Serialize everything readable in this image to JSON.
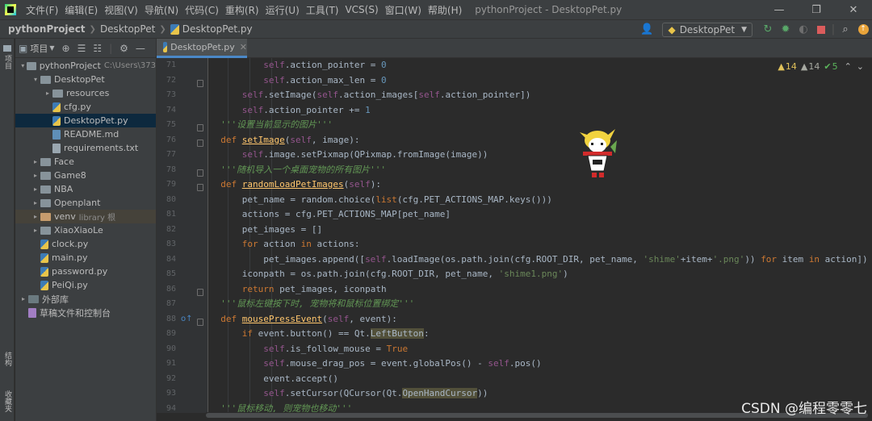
{
  "titlebar": {
    "menu": [
      "文件(F)",
      "编辑(E)",
      "视图(V)",
      "导航(N)",
      "代码(C)",
      "重构(R)",
      "运行(U)",
      "工具(T)",
      "VCS(S)",
      "窗口(W)",
      "帮助(H)"
    ],
    "title": "pythonProject - DesktopPet.py",
    "controls": [
      "—",
      "❐",
      "✕"
    ]
  },
  "navbar": {
    "breadcrumbs": [
      "pythonProject",
      "DesktopPet",
      "DesktopPet.py"
    ],
    "run_config": "DesktopPet"
  },
  "left_strip": {
    "top_label": "项目",
    "bottom_label_1": "结构",
    "bottom_label_2": "收藏夹"
  },
  "project_panel": {
    "label": "项目",
    "tree": [
      {
        "label": "pythonProject",
        "hint": "C:\\Users\\373",
        "indent": 0,
        "type": "folder",
        "arrow": "▾"
      },
      {
        "label": "DesktopPet",
        "indent": 1,
        "type": "folder",
        "arrow": "▾"
      },
      {
        "label": "resources",
        "indent": 2,
        "type": "folder",
        "arrow": "▸"
      },
      {
        "label": "cfg.py",
        "indent": 2,
        "type": "py"
      },
      {
        "label": "DesktopPet.py",
        "indent": 2,
        "type": "py",
        "selected": true
      },
      {
        "label": "README.md",
        "indent": 2,
        "type": "md"
      },
      {
        "label": "requirements.txt",
        "indent": 2,
        "type": "txt"
      },
      {
        "label": "Face",
        "indent": 1,
        "type": "folder",
        "arrow": "▸"
      },
      {
        "label": "Game8",
        "indent": 1,
        "type": "folder",
        "arrow": "▸"
      },
      {
        "label": "NBA",
        "indent": 1,
        "type": "folder",
        "arrow": "▸"
      },
      {
        "label": "Openplant",
        "indent": 1,
        "type": "folder",
        "arrow": "▸"
      },
      {
        "label": "venv",
        "hint": "library 根",
        "indent": 1,
        "type": "folder-orange",
        "arrow": "▸",
        "excluded": true
      },
      {
        "label": "XiaoXiaoLe",
        "indent": 1,
        "type": "folder",
        "arrow": "▸"
      },
      {
        "label": "clock.py",
        "indent": 1,
        "type": "py"
      },
      {
        "label": "main.py",
        "indent": 1,
        "type": "py"
      },
      {
        "label": "password.py",
        "indent": 1,
        "type": "py"
      },
      {
        "label": "PeiQi.py",
        "indent": 1,
        "type": "py"
      },
      {
        "label": "外部库",
        "indent": 0,
        "type": "lib",
        "arrow": "▸"
      },
      {
        "label": "草稿文件和控制台",
        "indent": 0,
        "type": "scratch"
      }
    ]
  },
  "editor": {
    "tab": "DesktopPet.py",
    "inspections": {
      "warnings": "14",
      "weak_warnings": "14",
      "ok": "5"
    },
    "line_numbers": [
      "71",
      "72",
      "73",
      "74",
      "75",
      "76",
      "77",
      "78",
      "79",
      "80",
      "81",
      "82",
      "83",
      "84",
      "85",
      "86",
      "87",
      "88",
      "89",
      "90",
      "91",
      "92",
      "93",
      "94"
    ]
  },
  "watermark": "CSDN @编程零零七"
}
